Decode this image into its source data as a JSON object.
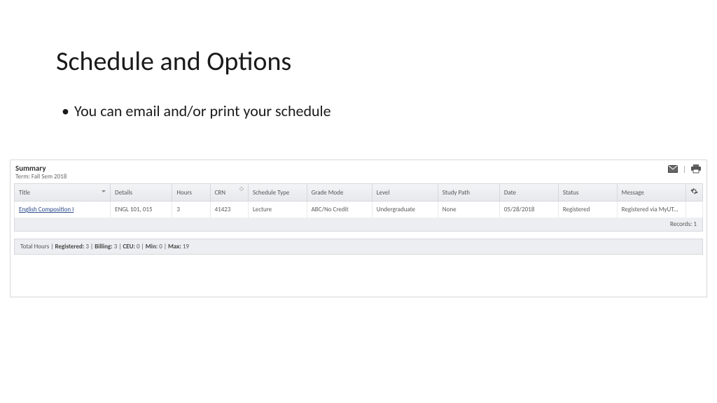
{
  "slide": {
    "title": "Schedule and Options",
    "bullet": "You can email and/or print your schedule"
  },
  "panel": {
    "summary_label": "Summary",
    "term_label": "Term: Fall Sem 2018",
    "headers": {
      "title": "Title",
      "details": "Details",
      "hours": "Hours",
      "crn": "CRN",
      "schedule_type": "Schedule Type",
      "grade_mode": "Grade Mode",
      "level": "Level",
      "study_path": "Study Path",
      "date": "Date",
      "status": "Status",
      "message": "Message"
    },
    "row": {
      "title": "English Composition I",
      "details": "ENGL 101, 015",
      "hours": "3",
      "crn": "41423",
      "schedule_type": "Lecture",
      "grade_mode": "ABC/No Credit",
      "level": "Undergraduate",
      "study_path": "None",
      "date": "05/28/2018",
      "status": "Registered",
      "message": "Registered via MyUT..."
    },
    "records": "Records: 1",
    "totals": {
      "prefix": "Total Hours | ",
      "reg_label": "Registered:",
      "reg_val": " 3 | ",
      "bill_label": "Billing:",
      "bill_val": " 3 | ",
      "ceu_label": "CEU:",
      "ceu_val": " 0 | ",
      "min_label": "Min:",
      "min_val": " 0 | ",
      "max_label": "Max:",
      "max_val": " 19"
    }
  }
}
